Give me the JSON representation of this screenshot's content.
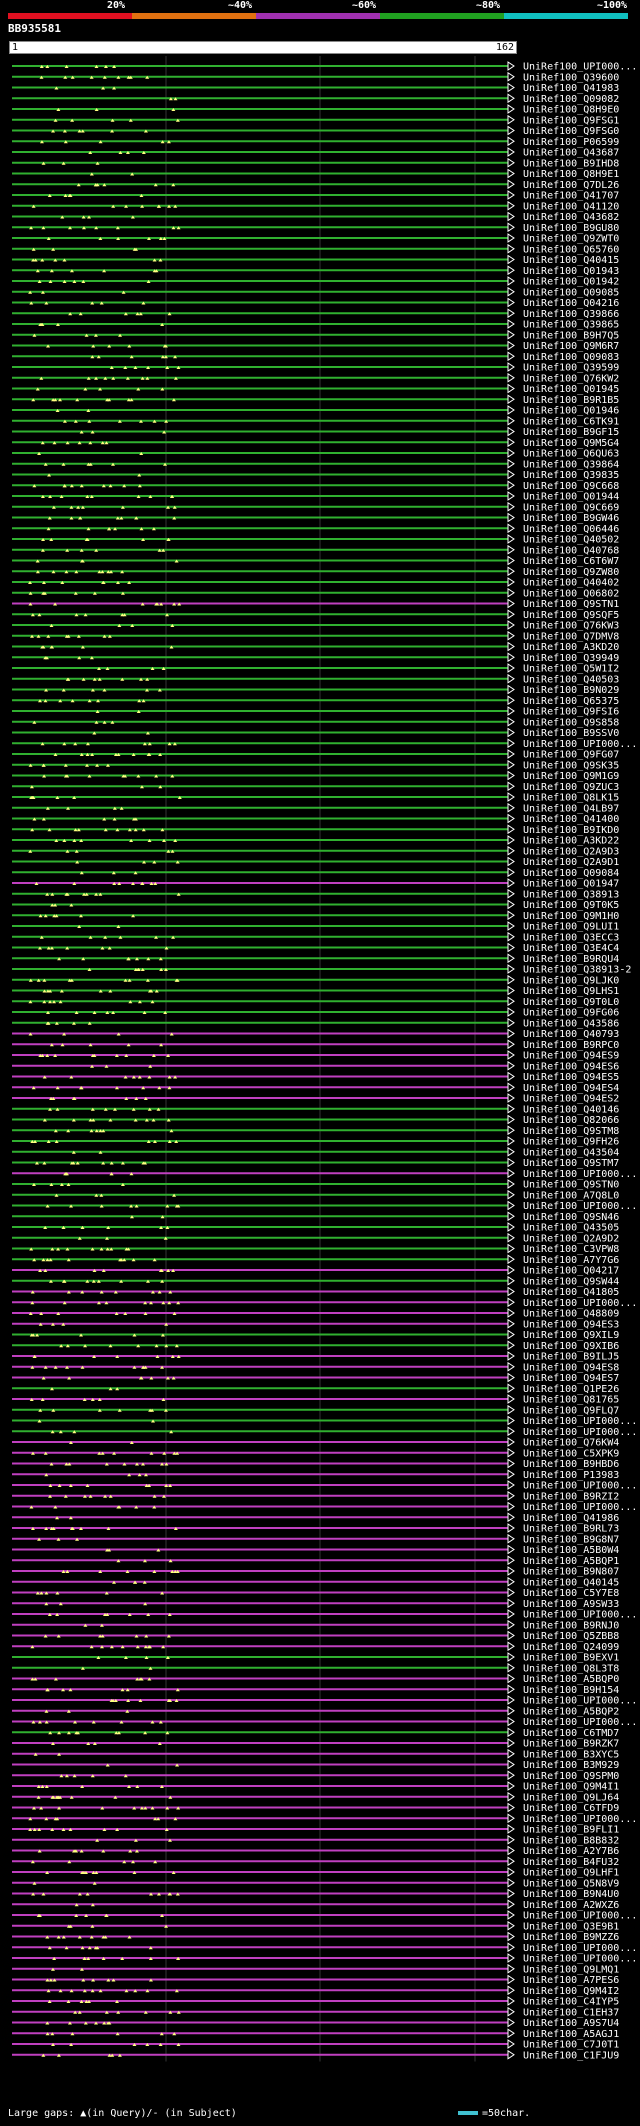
{
  "legend": {
    "labels": [
      "20%",
      "~40%",
      "~60%",
      "~80%",
      "~100%"
    ],
    "colors": [
      "#e01020",
      "#e07010",
      "#a030b0",
      "#20a020",
      "#10c0c0"
    ]
  },
  "query": {
    "name": "BB935581",
    "start": "1",
    "end": "162"
  },
  "hits": [
    {
      "name": "UniRef100_UPI000...",
      "color": "#30b030"
    },
    {
      "name": "UniRef100_Q39600",
      "color": "#30b030"
    },
    {
      "name": "UniRef100_Q41983",
      "color": "#30b030"
    },
    {
      "name": "UniRef100_Q09082",
      "color": "#30b030"
    },
    {
      "name": "UniRef100_Q8H9E0",
      "color": "#30b030"
    },
    {
      "name": "UniRef100_Q9FSG1",
      "color": "#30b030"
    },
    {
      "name": "UniRef100_Q9FSG0",
      "color": "#30b030"
    },
    {
      "name": "UniRef100_P06599",
      "color": "#30b030"
    },
    {
      "name": "UniRef100_Q43687",
      "color": "#30b030"
    },
    {
      "name": "UniRef100_B9IHD8",
      "color": "#30b030"
    },
    {
      "name": "UniRef100_Q8H9E1",
      "color": "#30b030"
    },
    {
      "name": "UniRef100_Q7DL26",
      "color": "#30b030"
    },
    {
      "name": "UniRef100_Q41707",
      "color": "#30b030"
    },
    {
      "name": "UniRef100_Q41120",
      "color": "#30b030"
    },
    {
      "name": "UniRef100_Q43682",
      "color": "#30b030"
    },
    {
      "name": "UniRef100_B9GU80",
      "color": "#30b030"
    },
    {
      "name": "UniRef100_Q9ZWT0",
      "color": "#30b030"
    },
    {
      "name": "UniRef100_Q65760",
      "color": "#30b030"
    },
    {
      "name": "UniRef100_Q40415",
      "color": "#30b030"
    },
    {
      "name": "UniRef100_Q01943",
      "color": "#30b030"
    },
    {
      "name": "UniRef100_Q01942",
      "color": "#30b030"
    },
    {
      "name": "UniRef100_Q09085",
      "color": "#30b030"
    },
    {
      "name": "UniRef100_Q04216",
      "color": "#30b030"
    },
    {
      "name": "UniRef100_Q39866",
      "color": "#30b030"
    },
    {
      "name": "UniRef100_Q39865",
      "color": "#30b030"
    },
    {
      "name": "UniRef100_B9H7Q5",
      "color": "#30b030"
    },
    {
      "name": "UniRef100_Q9M6R7",
      "color": "#30b030"
    },
    {
      "name": "UniRef100_Q09083",
      "color": "#30b030"
    },
    {
      "name": "UniRef100_Q39599",
      "color": "#30b030"
    },
    {
      "name": "UniRef100_Q76KW2",
      "color": "#30b030"
    },
    {
      "name": "UniRef100_Q01945",
      "color": "#30b030"
    },
    {
      "name": "UniRef100_B9R1B5",
      "color": "#30b030"
    },
    {
      "name": "UniRef100_Q01946",
      "color": "#30b030"
    },
    {
      "name": "UniRef100_C6TK91",
      "color": "#30b030"
    },
    {
      "name": "UniRef100_B9GF15",
      "color": "#30b030"
    },
    {
      "name": "UniRef100_Q9M5G4",
      "color": "#30b030"
    },
    {
      "name": "UniRef100_Q6QU63",
      "color": "#30b030"
    },
    {
      "name": "UniRef100_Q39864",
      "color": "#30b030"
    },
    {
      "name": "UniRef100_Q39835",
      "color": "#30b030"
    },
    {
      "name": "UniRef100_Q9C668",
      "color": "#30b030"
    },
    {
      "name": "UniRef100_Q01944",
      "color": "#30b030"
    },
    {
      "name": "UniRef100_Q9C669",
      "color": "#30b030"
    },
    {
      "name": "UniRef100_B9GW46",
      "color": "#30b030"
    },
    {
      "name": "UniRef100_Q06446",
      "color": "#30b030"
    },
    {
      "name": "UniRef100_Q40502",
      "color": "#30b030"
    },
    {
      "name": "UniRef100_Q40768",
      "color": "#30b030"
    },
    {
      "name": "UniRef100_C6T6W7",
      "color": "#30b030"
    },
    {
      "name": "UniRef100_Q9ZW80",
      "color": "#30b030"
    },
    {
      "name": "UniRef100_Q40402",
      "color": "#30b030"
    },
    {
      "name": "UniRef100_Q06802",
      "color": "#30b030"
    },
    {
      "name": "UniRef100_Q9STN1",
      "color": "#c040c0"
    },
    {
      "name": "UniRef100_Q9SQF5",
      "color": "#30b030"
    },
    {
      "name": "UniRef100_Q76KW3",
      "color": "#30b030"
    },
    {
      "name": "UniRef100_Q7DMV8",
      "color": "#30b030"
    },
    {
      "name": "UniRef100_A3KD20",
      "color": "#30b030"
    },
    {
      "name": "UniRef100_Q39949",
      "color": "#30b030"
    },
    {
      "name": "UniRef100_Q5W1I2",
      "color": "#30b030"
    },
    {
      "name": "UniRef100_Q40503",
      "color": "#30b030"
    },
    {
      "name": "UniRef100_B9N029",
      "color": "#30b030"
    },
    {
      "name": "UniRef100_Q65375",
      "color": "#30b030"
    },
    {
      "name": "UniRef100_Q9FSI6",
      "color": "#30b030"
    },
    {
      "name": "UniRef100_Q9S858",
      "color": "#30b030"
    },
    {
      "name": "UniRef100_B9SSV0",
      "color": "#30b030"
    },
    {
      "name": "UniRef100_UPI000...",
      "color": "#30b030"
    },
    {
      "name": "UniRef100_Q9FG07",
      "color": "#30b030"
    },
    {
      "name": "UniRef100_Q9SK35",
      "color": "#30b030"
    },
    {
      "name": "UniRef100_Q9M1G9",
      "color": "#30b030"
    },
    {
      "name": "UniRef100_Q9ZUC3",
      "color": "#30b030"
    },
    {
      "name": "UniRef100_Q8LK15",
      "color": "#30b030"
    },
    {
      "name": "UniRef100_Q4LB97",
      "color": "#30b030"
    },
    {
      "name": "UniRef100_Q41400",
      "color": "#30b030"
    },
    {
      "name": "UniRef100_B9IKD0",
      "color": "#30b030"
    },
    {
      "name": "UniRef100_A3KD22",
      "color": "#30b030"
    },
    {
      "name": "UniRef100_Q2A9D3",
      "color": "#30b030"
    },
    {
      "name": "UniRef100_Q2A9D1",
      "color": "#30b030"
    },
    {
      "name": "UniRef100_Q09084",
      "color": "#30b030"
    },
    {
      "name": "UniRef100_Q01947",
      "color": "#c040c0"
    },
    {
      "name": "UniRef100_Q38913",
      "color": "#30b030"
    },
    {
      "name": "UniRef100_Q9T0K5",
      "color": "#30b030"
    },
    {
      "name": "UniRef100_Q9M1H0",
      "color": "#30b030"
    },
    {
      "name": "UniRef100_Q9LUI1",
      "color": "#30b030"
    },
    {
      "name": "UniRef100_Q3ECC3",
      "color": "#30b030"
    },
    {
      "name": "UniRef100_Q3E4C4",
      "color": "#30b030"
    },
    {
      "name": "UniRef100_B9RQU4",
      "color": "#30b030"
    },
    {
      "name": "UniRef100_Q38913-2",
      "color": "#30b030"
    },
    {
      "name": "UniRef100_Q9LJK0",
      "color": "#30b030"
    },
    {
      "name": "UniRef100_Q9LHS1",
      "color": "#30b030"
    },
    {
      "name": "UniRef100_Q9T0L0",
      "color": "#30b030"
    },
    {
      "name": "UniRef100_Q9FG06",
      "color": "#30b030"
    },
    {
      "name": "UniRef100_Q43586",
      "color": "#30b030"
    },
    {
      "name": "UniRef100_Q40793",
      "color": "#c040c0"
    },
    {
      "name": "UniRef100_B9RPC0",
      "color": "#c040c0"
    },
    {
      "name": "UniRef100_Q94ES9",
      "color": "#c040c0"
    },
    {
      "name": "UniRef100_Q94ES6",
      "color": "#c040c0"
    },
    {
      "name": "UniRef100_Q94ES5",
      "color": "#c040c0"
    },
    {
      "name": "UniRef100_Q94ES4",
      "color": "#c040c0"
    },
    {
      "name": "UniRef100_Q94ES2",
      "color": "#c040c0"
    },
    {
      "name": "UniRef100_Q40146",
      "color": "#30b030"
    },
    {
      "name": "UniRef100_Q82066",
      "color": "#30b030"
    },
    {
      "name": "UniRef100_Q9STM8",
      "color": "#30b030"
    },
    {
      "name": "UniRef100_Q9FH26",
      "color": "#30b030"
    },
    {
      "name": "UniRef100_Q43504",
      "color": "#30b030"
    },
    {
      "name": "UniRef100_Q9STM7",
      "color": "#30b030"
    },
    {
      "name": "UniRef100_UPI000...",
      "color": "#c040c0"
    },
    {
      "name": "UniRef100_Q9STN0",
      "color": "#30b030"
    },
    {
      "name": "UniRef100_A7Q8L0",
      "color": "#30b030"
    },
    {
      "name": "UniRef100_UPI000...",
      "color": "#30b030"
    },
    {
      "name": "UniRef100_Q9SN46",
      "color": "#30b030"
    },
    {
      "name": "UniRef100_Q43505",
      "color": "#30b030"
    },
    {
      "name": "UniRef100_Q2A9D2",
      "color": "#30b030"
    },
    {
      "name": "UniRef100_C3VPW8",
      "color": "#30b030"
    },
    {
      "name": "UniRef100_A7Y7G6",
      "color": "#30b030"
    },
    {
      "name": "UniRef100_Q04217",
      "color": "#c040c0"
    },
    {
      "name": "UniRef100_Q9SW44",
      "color": "#30b030"
    },
    {
      "name": "UniRef100_Q41805",
      "color": "#c040c0"
    },
    {
      "name": "UniRef100_UPI000...",
      "color": "#c040c0"
    },
    {
      "name": "UniRef100_Q48809",
      "color": "#c040c0"
    },
    {
      "name": "UniRef100_Q94ES3",
      "color": "#c040c0"
    },
    {
      "name": "UniRef100_Q9XIL9",
      "color": "#30b030"
    },
    {
      "name": "UniRef100_Q9XIB6",
      "color": "#30b030"
    },
    {
      "name": "UniRef100_B9ILJ5",
      "color": "#c040c0"
    },
    {
      "name": "UniRef100_Q94ES8",
      "color": "#c040c0"
    },
    {
      "name": "UniRef100_Q94ES7",
      "color": "#c040c0"
    },
    {
      "name": "UniRef100_Q1PE26",
      "color": "#30b030"
    },
    {
      "name": "UniRef100_Q81765",
      "color": "#c040c0"
    },
    {
      "name": "UniRef100_Q9FLQ7",
      "color": "#30b030"
    },
    {
      "name": "UniRef100_UPI000...",
      "color": "#30b030"
    },
    {
      "name": "UniRef100_UPI000...",
      "color": "#30b030"
    },
    {
      "name": "UniRef100_Q76KW4",
      "color": "#c040c0"
    },
    {
      "name": "UniRef100_C5XPK9",
      "color": "#c040c0"
    },
    {
      "name": "UniRef100_B9HBD6",
      "color": "#c040c0"
    },
    {
      "name": "UniRef100_P13983",
      "color": "#c040c0"
    },
    {
      "name": "UniRef100_UPI000...",
      "color": "#c040c0"
    },
    {
      "name": "UniRef100_B9RZI2",
      "color": "#c040c0"
    },
    {
      "name": "UniRef100_UPI000...",
      "color": "#c040c0"
    },
    {
      "name": "UniRef100_Q41986",
      "color": "#c040c0"
    },
    {
      "name": "UniRef100_B9RL73",
      "color": "#c040c0"
    },
    {
      "name": "UniRef100_B9G8N7",
      "color": "#c040c0"
    },
    {
      "name": "UniRef100_A5B0W4",
      "color": "#c040c0"
    },
    {
      "name": "UniRef100_A5BQP1",
      "color": "#c040c0"
    },
    {
      "name": "UniRef100_B9N807",
      "color": "#c040c0"
    },
    {
      "name": "UniRef100_Q40145",
      "color": "#c040c0"
    },
    {
      "name": "UniRef100_C5Y7E8",
      "color": "#c040c0"
    },
    {
      "name": "UniRef100_A9SW33",
      "color": "#c040c0"
    },
    {
      "name": "UniRef100_UPI000...",
      "color": "#c040c0"
    },
    {
      "name": "UniRef100_B9RNJ0",
      "color": "#c040c0"
    },
    {
      "name": "UniRef100_Q5ZBB8",
      "color": "#c040c0"
    },
    {
      "name": "UniRef100_Q24099",
      "color": "#c040c0"
    },
    {
      "name": "UniRef100_B9EXV1",
      "color": "#30b030"
    },
    {
      "name": "UniRef100_Q8L3T8",
      "color": "#30b030"
    },
    {
      "name": "UniRef100_A5BQP0",
      "color": "#c040c0"
    },
    {
      "name": "UniRef100_B9H154",
      "color": "#c040c0"
    },
    {
      "name": "UniRef100_UPI000...",
      "color": "#c040c0"
    },
    {
      "name": "UniRef100_A5BQP2",
      "color": "#c040c0"
    },
    {
      "name": "UniRef100_UPI000...",
      "color": "#c040c0"
    },
    {
      "name": "UniRef100_C6TMD7",
      "color": "#30b030"
    },
    {
      "name": "UniRef100_B9RZK7",
      "color": "#c040c0"
    },
    {
      "name": "UniRef100_B3XYC5",
      "color": "#c040c0"
    },
    {
      "name": "UniRef100_B3M929",
      "color": "#c040c0"
    },
    {
      "name": "UniRef100_Q9SPM0",
      "color": "#c040c0"
    },
    {
      "name": "UniRef100_Q9M4I1",
      "color": "#c040c0"
    },
    {
      "name": "UniRef100_Q9LJ64",
      "color": "#c040c0"
    },
    {
      "name": "UniRef100_C6TFD9",
      "color": "#c040c0"
    },
    {
      "name": "UniRef100_UPI000...",
      "color": "#c040c0"
    },
    {
      "name": "UniRef100_B9FLI1",
      "color": "#c040c0"
    },
    {
      "name": "UniRef100_B8B832",
      "color": "#c040c0"
    },
    {
      "name": "UniRef100_A2Y7B6",
      "color": "#c040c0"
    },
    {
      "name": "UniRef100_B4FU32",
      "color": "#c040c0"
    },
    {
      "name": "UniRef100_Q9LHF1",
      "color": "#c040c0"
    },
    {
      "name": "UniRef100_Q5N8V9",
      "color": "#c040c0"
    },
    {
      "name": "UniRef100_B9N4U0",
      "color": "#c040c0"
    },
    {
      "name": "UniRef100_A2WXZ6",
      "color": "#c040c0"
    },
    {
      "name": "UniRef100_UPI000...",
      "color": "#c040c0"
    },
    {
      "name": "UniRef100_Q3E9B1",
      "color": "#c040c0"
    },
    {
      "name": "UniRef100_B9MZZ6",
      "color": "#c040c0"
    },
    {
      "name": "UniRef100_UPI000...",
      "color": "#c040c0"
    },
    {
      "name": "UniRef100_UPI000...",
      "color": "#c040c0"
    },
    {
      "name": "UniRef100_Q9LMQ1",
      "color": "#c040c0"
    },
    {
      "name": "UniRef100_A7PES6",
      "color": "#c040c0"
    },
    {
      "name": "UniRef100_Q9M4I2",
      "color": "#c040c0"
    },
    {
      "name": "UniRef100_C4IYP5",
      "color": "#c040c0"
    },
    {
      "name": "UniRef100_C1EH37",
      "color": "#c040c0"
    },
    {
      "name": "UniRef100_A9S7U4",
      "color": "#c040c0"
    },
    {
      "name": "UniRef100_A5AGJ1",
      "color": "#c040c0"
    },
    {
      "name": "UniRef100_C7J0T1",
      "color": "#c040c0"
    },
    {
      "name": "UniRef100_C1FJU9",
      "color": "#c040c0"
    }
  ],
  "footer": {
    "gap_legend": "Large gaps: ▲(in Query)/- (in Subject)",
    "scale_label": "=50char."
  }
}
